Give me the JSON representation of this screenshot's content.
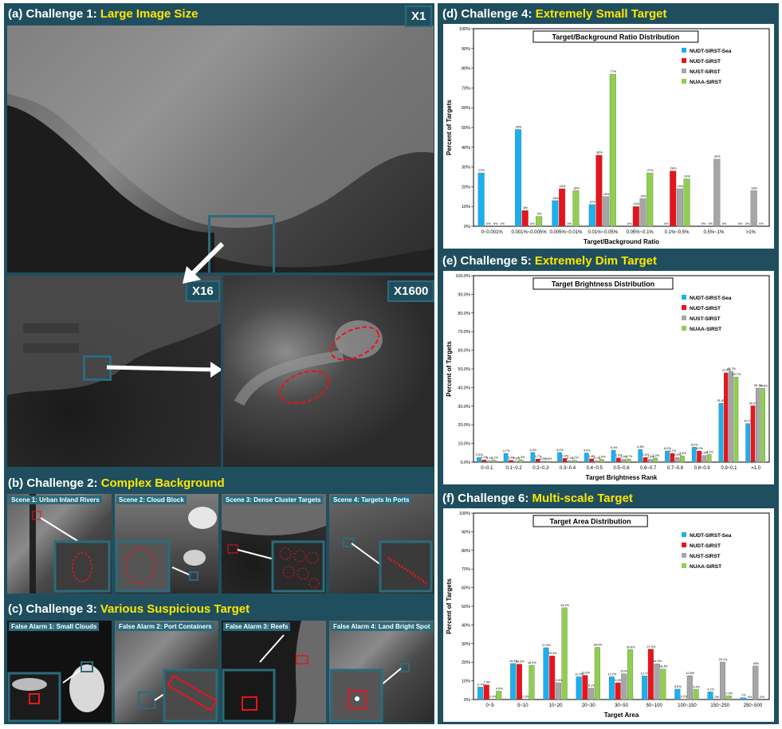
{
  "panels": {
    "a": {
      "prefix": "(a) Challenge 1: ",
      "highlight": "Large Image Size",
      "zoom": [
        "X1",
        "X16",
        "X1600"
      ]
    },
    "b": {
      "prefix": "(b) Challenge 2: ",
      "highlight": "Complex Background",
      "scenes": [
        "Scene 1: Urban Inland Rivers",
        "Scene 2: Cloud Block",
        "Scene 3: Dense Cluster Targets",
        "Scene 4: Targets In Ports"
      ]
    },
    "c": {
      "prefix": "(c) Challenge 3: ",
      "highlight": "Various Suspicious Target",
      "scenes": [
        "False Alarm 1: Small Clouds",
        "False Alarm 2: Port Containers",
        "False Alarm 3: Reefs",
        "False Alarm 4: Land Bright Spot"
      ]
    },
    "d": {
      "prefix": "(d) Challenge 4: ",
      "highlight": "Extremely Small Target"
    },
    "e": {
      "prefix": "(e) Challenge 5: ",
      "highlight": "Extremely Dim Target"
    },
    "f": {
      "prefix": "(f) Challenge 6: ",
      "highlight": "Multi-scale Target"
    }
  },
  "colors": {
    "panel": "#1f4f5f",
    "highlight": "#ffe600",
    "series": [
      "#1ab0f0",
      "#e8141c",
      "#a6a6a6",
      "#8fcf4f"
    ]
  },
  "chart_data": [
    {
      "type": "bar",
      "title": "Target/Background Ratio Distribution",
      "xlabel": "Target/Background Ratio",
      "ylabel": "Percent of Targets",
      "ylim": [
        0,
        100
      ],
      "yticks": [
        "0%",
        "10%",
        "20%",
        "30%",
        "40%",
        "50%",
        "60%",
        "70%",
        "80%",
        "90%",
        "100%"
      ],
      "legend_position": "top-right",
      "categories": [
        "0~0.001%",
        "0.001%~0.005%",
        "0.005%~0.01%",
        "0.01%~0.05%",
        "0.05%~0.1%",
        "0.1%~0.5%",
        "0.5%~1%",
        ">1%"
      ],
      "series": [
        {
          "name": "NUDT-SIRST-Sea",
          "values": [
            27,
            49,
            13,
            11,
            0,
            0,
            0,
            0
          ],
          "labels": [
            "27%",
            "49%",
            "13%",
            "11%",
            "0%",
            "0%",
            "0%",
            "0%"
          ]
        },
        {
          "name": "NUDT-SIRST",
          "values": [
            0,
            8,
            19,
            36,
            10,
            28,
            0,
            0
          ],
          "labels": [
            "0%",
            "8%",
            "19%",
            "36%",
            "10%",
            "28%",
            "0%",
            "0%"
          ]
        },
        {
          "name": "NUST-SIRST",
          "values": [
            0,
            0,
            0,
            15,
            14,
            19,
            34,
            18
          ],
          "labels": [
            "0%",
            "0%",
            "0%",
            "15%",
            "14%",
            "19%",
            "34%",
            "18%"
          ]
        },
        {
          "name": "NUAA-SIRST",
          "values": [
            0,
            5,
            18,
            77,
            27,
            24,
            0,
            0
          ],
          "labels": [
            "0%",
            "5%",
            "18%",
            "77%",
            "27%",
            "24%",
            "0%",
            "0%"
          ]
        }
      ]
    },
    {
      "type": "bar",
      "title": "Target Brightness Distribution",
      "xlabel": "Target Brightness Rank",
      "ylabel": "Percent of Targets",
      "ylim": [
        0,
        100
      ],
      "yticks": [
        "0.0%",
        "10.0%",
        "20.0%",
        "30.0%",
        "40.0%",
        "50.0%",
        "60.0%",
        "70.0%",
        "80.0%",
        "90.0%",
        "100.0%"
      ],
      "legend_position": "top-right",
      "categories": [
        "0~0.1",
        "0.1~0.2",
        "0.2~0.3",
        "0.3~0.4",
        "0.4~0.5",
        "0.5~0.6",
        "0.6~0.7",
        "0.7~0.8",
        "0.8~0.9",
        "0.9~0.1",
        "=1.0"
      ],
      "series": [
        {
          "name": "NUDT-SIRST-Sea",
          "values": [
            2.5,
            4.7,
            5.2,
            5.2,
            4.9,
            6.4,
            6.8,
            6.0,
            8.0,
            31.6,
            20.7
          ],
          "labels": [
            "2.5%",
            "4.7%",
            "5.2%",
            "5.2%",
            "4.9%",
            "6.4%",
            "6.8%",
            "6.0%",
            "8.0%",
            "31.6%",
            "20.7%"
          ]
        },
        {
          "name": "NUDT-SIRST",
          "values": [
            1.2,
            1.0,
            1.7,
            2.0,
            1.8,
            2.3,
            2.5,
            4.7,
            6.0,
            47.9,
            30.2
          ],
          "labels": [
            "1.2%",
            "1.0%",
            "1.7%",
            "2.0%",
            "1.8%",
            "2.3%",
            "2.5%",
            "4.7%",
            "6.0%",
            "47.9%",
            "30.2%"
          ]
        },
        {
          "name": "NUST-SIRST",
          "values": [
            0.7,
            0.6,
            0.5,
            0.7,
            0.7,
            1.5,
            1.5,
            2.5,
            3.6,
            48.7,
            39.7
          ],
          "labels": [
            "0.7%",
            "0.6%",
            "0.5%",
            "0.7%",
            "0.7%",
            "1.5%",
            "1.5%",
            "2.5%",
            "3.6%",
            "48.7%",
            "39.7%"
          ]
        },
        {
          "name": "NUAA-SIRST",
          "values": [
            1.1,
            1.3,
            0.5,
            1.0,
            1.5,
            1.7,
            2.2,
            3.4,
            4.1,
            45.7,
            39.6
          ],
          "labels": [
            "1.1%",
            "1.3%",
            "0.5%",
            "1.0%",
            "1.5%",
            "1.7%",
            "2.2%",
            "3.4%",
            "4.1%",
            "45.7%",
            "39.6%"
          ]
        }
      ]
    },
    {
      "type": "bar",
      "title": "Target Area Distribution",
      "xlabel": "Target Area",
      "ylabel": "Percent of Targets",
      "ylim": [
        0,
        100
      ],
      "yticks": [
        "0%",
        "10%",
        "20%",
        "30%",
        "40%",
        "50%",
        "60%",
        "70%",
        "80%",
        "90%",
        "100%"
      ],
      "legend_position": "top-right",
      "categories": [
        "0~5",
        "5~10",
        "10~20",
        "20~30",
        "30~50",
        "50~100",
        "100~150",
        "150~250",
        "250~500"
      ],
      "series": [
        {
          "name": "NUDT-SIRST-Sea",
          "values": [
            6.7,
            19.3,
            27.8,
            12.2,
            12.2,
            12.7,
            5.6,
            4.1,
            1.0
          ],
          "labels": [
            "6.7%",
            "19.3%",
            "27.8%",
            "12.2%",
            "12.2%",
            "12.7%",
            "5.6%",
            "4.1%",
            "1%"
          ]
        },
        {
          "name": "NUDT-SIRST",
          "values": [
            7.9,
            19.0,
            23.4,
            13.0,
            9.0,
            27.0,
            0.2,
            0.0,
            0.0
          ],
          "labels": [
            "7.9%",
            "19.0%",
            "23.4%",
            "13.0%",
            "9.0%",
            "27.0%",
            "0.2%",
            "0%",
            "0%"
          ]
        },
        {
          "name": "NUST-SIRST",
          "values": [
            0.3,
            0.3,
            9.0,
            6.1,
            13.8,
            19.2,
            12.8,
            20.1,
            18.0
          ],
          "labels": [
            "0.3%",
            "0.3%",
            "9.0%",
            "6.1%",
            "13.8%",
            "19.2%",
            "12.8%",
            "20.1%",
            "18%"
          ]
        },
        {
          "name": "NUAA-SIRST",
          "values": [
            4.5,
            18.4,
            49.2,
            28.0,
            26.8,
            16.4,
            5.4,
            2.0,
            0.0
          ],
          "labels": [
            "4.5%",
            "18.4%",
            "49.2%",
            "28.0%",
            "26.8%",
            "16.4%",
            "5.4%",
            "2.0%",
            "0%"
          ]
        }
      ]
    }
  ]
}
